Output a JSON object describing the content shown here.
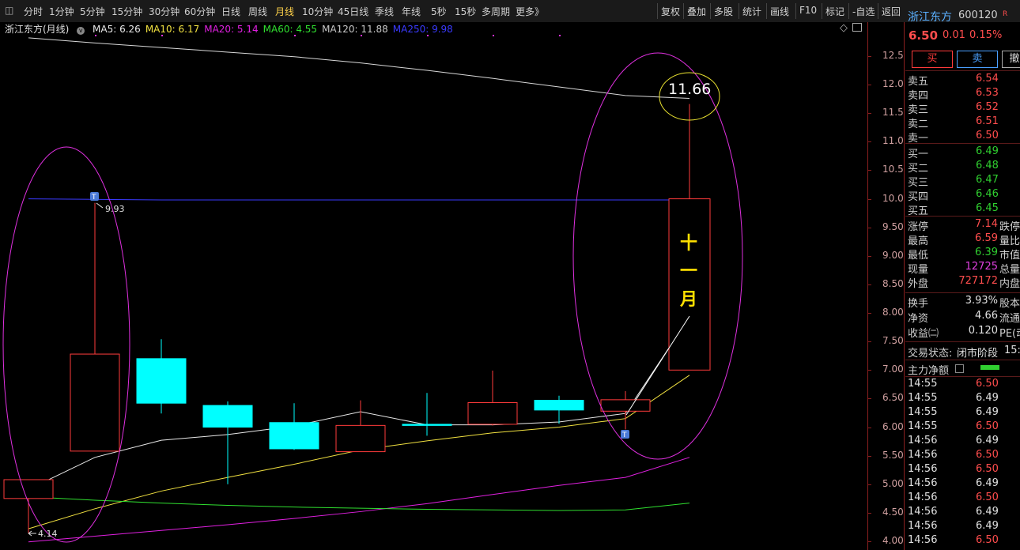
{
  "toolbar_left": [
    "分时",
    "1分钟",
    "5分钟",
    "15分钟",
    "30分钟",
    "60分钟",
    "日线",
    "周线",
    "月线",
    "10分钟",
    "45日线",
    "季线",
    "年线",
    "5秒",
    "15秒",
    "多周期",
    "更多》"
  ],
  "toolbar_active": "月线",
  "toolbar_right": [
    "复权",
    "叠加",
    "多股",
    "统计",
    "画线",
    "F10",
    "标记",
    "-自选",
    "返回"
  ],
  "legend": {
    "stock_name": "浙江东方(月线)",
    "ma": [
      {
        "label": "MA5: 6.26",
        "color": "#e8e8e8"
      },
      {
        "label": "MA10: 6.17",
        "color": "#f0e040"
      },
      {
        "label": "MA20: 5.14",
        "color": "#e020e0"
      },
      {
        "label": "MA60: 4.55",
        "color": "#30e030"
      },
      {
        "label": "MA120: 11.88",
        "color": "#c8c8c8"
      },
      {
        "label": "MA250: 9.98",
        "color": "#3a3aff"
      }
    ]
  },
  "price_axis": [
    "12.50",
    "12.00",
    "11.50",
    "11.00",
    "10.50",
    "10.00",
    "9.50",
    "9.00",
    "8.50",
    "8.00",
    "7.50",
    "7.00",
    "6.50",
    "6.00",
    "5.50",
    "5.00",
    "4.50",
    "4.00"
  ],
  "chart_data": {
    "type": "candlestick",
    "period": "月线",
    "ylim": [
      4.0,
      12.5
    ],
    "candles": [
      {
        "open": 4.75,
        "close": 5.08,
        "high": 5.08,
        "low": 4.14,
        "up": true
      },
      {
        "open": 5.58,
        "close": 7.28,
        "high": 9.93,
        "low": 5.58,
        "up": true
      },
      {
        "open": 7.2,
        "close": 6.42,
        "high": 7.54,
        "low": 6.24,
        "up": false
      },
      {
        "open": 6.38,
        "close": 6.0,
        "high": 6.45,
        "low": 5.0,
        "up": false
      },
      {
        "open": 6.08,
        "close": 5.62,
        "high": 6.42,
        "low": 5.6,
        "up": false
      },
      {
        "open": 5.57,
        "close": 6.03,
        "high": 6.47,
        "low": 5.57,
        "up": true
      },
      {
        "open": 6.05,
        "close": 6.03,
        "high": 6.6,
        "low": 5.85,
        "up": false
      },
      {
        "open": 6.05,
        "close": 6.43,
        "high": 6.99,
        "low": 6.03,
        "up": true
      },
      {
        "open": 6.47,
        "close": 6.3,
        "high": 6.55,
        "low": 6.06,
        "up": false
      },
      {
        "open": 6.28,
        "close": 6.48,
        "high": 6.63,
        "low": 5.96,
        "up": true
      },
      {
        "open": 7.0,
        "close": 10.0,
        "high": 11.66,
        "low": 7.0,
        "up": true
      }
    ],
    "ma_lines": [
      {
        "name": "MA5",
        "color": "#e8e8e8",
        "values": [
          4.91,
          5.47,
          5.77,
          5.87,
          6.02,
          6.27,
          6.04,
          6.04,
          6.09,
          6.24,
          7.93
        ]
      },
      {
        "name": "MA10",
        "color": "#f0e040",
        "values": [
          4.22,
          4.57,
          4.88,
          5.12,
          5.35,
          5.6,
          5.76,
          5.9,
          6.0,
          6.15,
          6.91
        ]
      },
      {
        "name": "MA20",
        "color": "#e020e0",
        "values": [
          3.99,
          4.09,
          4.19,
          4.29,
          4.4,
          4.52,
          4.66,
          4.82,
          4.98,
          5.12,
          5.47
        ]
      },
      {
        "name": "MA60",
        "color": "#30e030",
        "values": [
          4.78,
          4.72,
          4.67,
          4.63,
          4.6,
          4.58,
          4.56,
          4.55,
          4.54,
          4.55,
          4.67
        ]
      },
      {
        "name": "MA120",
        "color": "#d8d8d8",
        "values": [
          12.82,
          12.73,
          12.65,
          12.57,
          12.49,
          12.38,
          12.25,
          12.11,
          11.96,
          11.81,
          11.76
        ]
      },
      {
        "name": "MA250",
        "color": "#3a3aff",
        "values": [
          10.0,
          9.99,
          9.98,
          9.98,
          9.98,
          9.98,
          9.98,
          9.98,
          9.98,
          9.98,
          9.98
        ]
      }
    ],
    "annotations": {
      "high_label": "9.93",
      "low_label": "4.14",
      "peak_label": "11.66",
      "month_text": [
        "十",
        "一",
        "月"
      ]
    }
  },
  "quote": {
    "name": "浙江东方",
    "code": "600120",
    "tag": "R",
    "price": "6.50",
    "change": "0.01",
    "pct": "0.15%",
    "buy_btn": "买",
    "sell_btn": "卖",
    "third_btn": "撤",
    "asks": [
      {
        "label": "卖五",
        "price": "6.54"
      },
      {
        "label": "卖四",
        "price": "6.53"
      },
      {
        "label": "卖三",
        "price": "6.52"
      },
      {
        "label": "卖二",
        "price": "6.51"
      },
      {
        "label": "卖一",
        "price": "6.50"
      }
    ],
    "bids": [
      {
        "label": "买一",
        "price": "6.49"
      },
      {
        "label": "买二",
        "price": "6.48"
      },
      {
        "label": "买三",
        "price": "6.47"
      },
      {
        "label": "买四",
        "price": "6.46"
      },
      {
        "label": "买五",
        "price": "6.45"
      }
    ],
    "stats": [
      {
        "label": "涨停",
        "value": "7.14",
        "color": "#ff4d4d",
        "label2": "跌停"
      },
      {
        "label": "最高",
        "value": "6.59",
        "color": "#ff4d4d",
        "label2": "量比"
      },
      {
        "label": "最低",
        "value": "6.39",
        "color": "#30d030",
        "label2": "市值"
      },
      {
        "label": "现量",
        "value": "12725",
        "color": "#e040e0",
        "label2": "总量"
      },
      {
        "label": "外盘",
        "value": "727172",
        "color": "#ff4d4d",
        "label2": "内盘"
      }
    ],
    "stats2": [
      {
        "label": "换手",
        "value": "3.93%",
        "label2": "股本"
      },
      {
        "label": "净资",
        "value": "4.66",
        "label2": "流通"
      },
      {
        "label": "收益㈡",
        "value": "0.120",
        "label2": "PE(动"
      }
    ],
    "trade_state_label": "交易状态:",
    "trade_state": "闭市阶段",
    "trade_time": "15:",
    "flow_label": "主力净额",
    "ticks": [
      {
        "t": "14:55",
        "p": "6.50",
        "up": true
      },
      {
        "t": "14:55",
        "p": "6.49",
        "up": false
      },
      {
        "t": "14:55",
        "p": "6.49",
        "up": false
      },
      {
        "t": "14:55",
        "p": "6.50",
        "up": true
      },
      {
        "t": "14:56",
        "p": "6.49",
        "up": false
      },
      {
        "t": "14:56",
        "p": "6.50",
        "up": true
      },
      {
        "t": "14:56",
        "p": "6.50",
        "up": true
      },
      {
        "t": "14:56",
        "p": "6.49",
        "up": false
      },
      {
        "t": "14:56",
        "p": "6.50",
        "up": true
      },
      {
        "t": "14:56",
        "p": "6.49",
        "up": false
      },
      {
        "t": "14:56",
        "p": "6.49",
        "up": false
      },
      {
        "t": "14:56",
        "p": "6.50",
        "up": true
      }
    ]
  }
}
